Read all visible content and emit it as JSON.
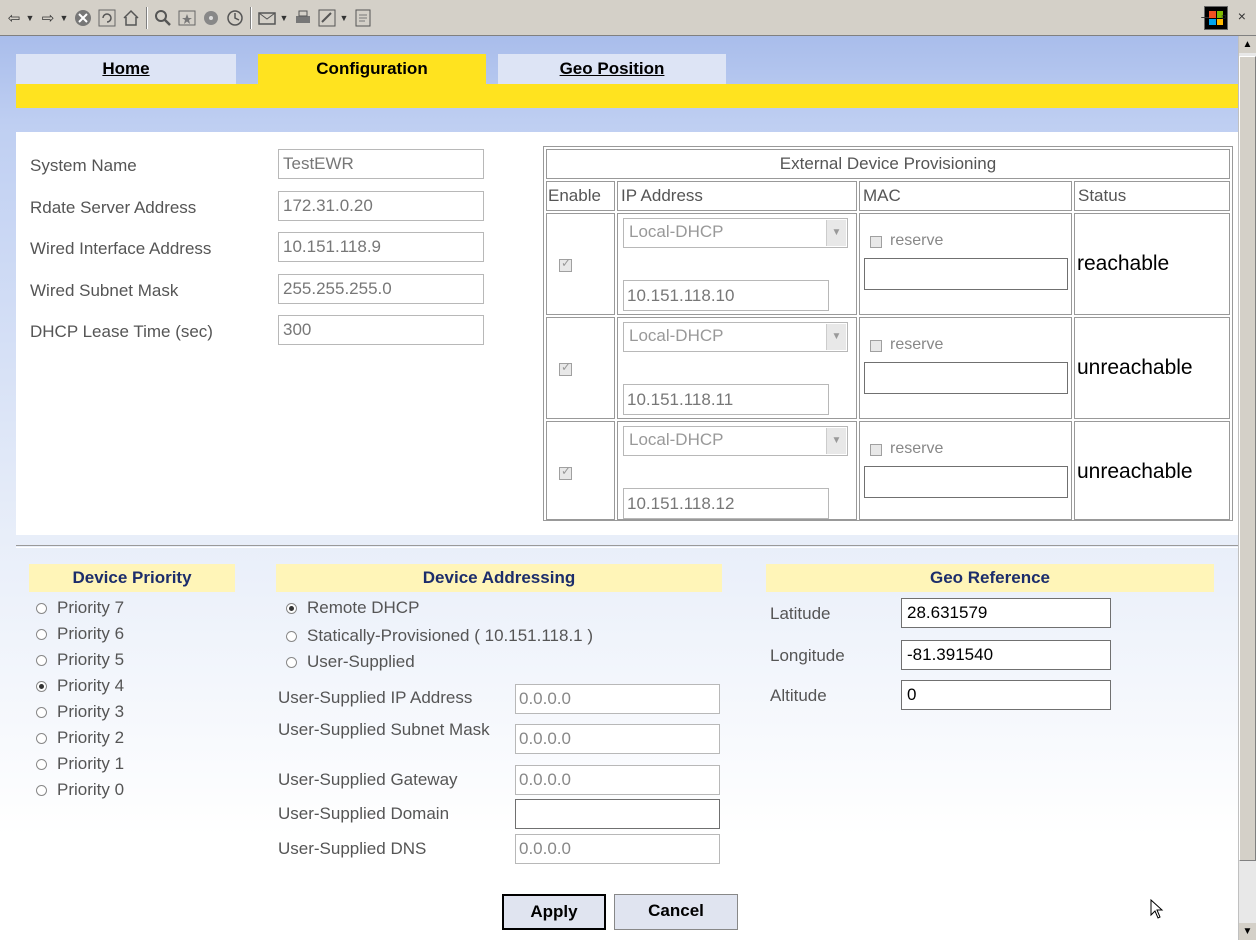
{
  "toolbar": {
    "icons": [
      "back-icon",
      "forward-icon",
      "stop-icon",
      "refresh-icon",
      "home-icon",
      "search-icon",
      "favorites-icon",
      "media-icon",
      "history-icon",
      "mail-icon",
      "print-icon",
      "edit-icon",
      "discuss-icon"
    ],
    "window_controls": "– ▫ ×"
  },
  "tabs": {
    "home": "Home",
    "configuration": "Configuration",
    "geo_position": "Geo Position"
  },
  "system": {
    "fields": [
      {
        "label": "System Name",
        "value": "TestEWR"
      },
      {
        "label": "Rdate Server Address",
        "value": "172.31.0.20"
      },
      {
        "label": "Wired Interface Address",
        "value": "10.151.118.9"
      },
      {
        "label": "Wired Subnet Mask",
        "value": "255.255.255.0"
      },
      {
        "label": "DHCP Lease Time (sec)",
        "value": "300"
      }
    ]
  },
  "edp": {
    "title": "External Device Provisioning",
    "headers": {
      "enable": "Enable",
      "ip": "IP Address",
      "mac": "MAC",
      "status": "Status"
    },
    "rows": [
      {
        "enabled": true,
        "mode": "Local-DHCP",
        "ip": "10.151.118.10",
        "reserve_label": "reserve",
        "reserve": false,
        "mac": "",
        "status": "reachable"
      },
      {
        "enabled": true,
        "mode": "Local-DHCP",
        "ip": "10.151.118.11",
        "reserve_label": "reserve",
        "reserve": false,
        "mac": "",
        "status": "unreachable"
      },
      {
        "enabled": true,
        "mode": "Local-DHCP",
        "ip": "10.151.118.12",
        "reserve_label": "reserve",
        "reserve": false,
        "mac": "",
        "status": "unreachable"
      }
    ]
  },
  "priority": {
    "title": "Device Priority",
    "options": [
      "Priority 7",
      "Priority 6",
      "Priority 5",
      "Priority 4",
      "Priority 3",
      "Priority 2",
      "Priority 1",
      "Priority 0"
    ],
    "selected": "Priority 4"
  },
  "addressing": {
    "title": "Device Addressing",
    "options": [
      "Remote DHCP",
      "Statically-Provisioned ( 10.151.118.1 )",
      "User-Supplied"
    ],
    "selected": "Remote DHCP",
    "fields": [
      {
        "label": "User-Supplied IP Address",
        "value": "0.0.0.0"
      },
      {
        "label": "User-Supplied Subnet Mask",
        "value": "0.0.0.0"
      },
      {
        "label": "User-Supplied Gateway",
        "value": "0.0.0.0"
      },
      {
        "label": "User-Supplied Domain",
        "value": ""
      },
      {
        "label": "User-Supplied DNS",
        "value": "0.0.0.0"
      }
    ]
  },
  "geo": {
    "title": "Geo Reference",
    "fields": [
      {
        "label": "Latitude",
        "value": "28.631579"
      },
      {
        "label": "Longitude",
        "value": "-81.391540"
      },
      {
        "label": "Altitude",
        "value": "0"
      }
    ]
  },
  "buttons": {
    "apply": "Apply",
    "cancel": "Cancel"
  }
}
